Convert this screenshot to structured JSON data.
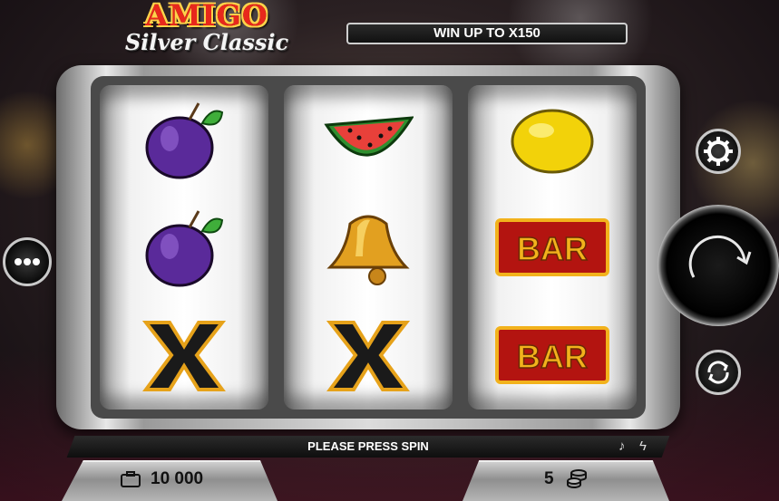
{
  "logo": {
    "line1": "AMIGO",
    "line2": "Silver Classic"
  },
  "header": {
    "win_banner": "WIN UP TO X150"
  },
  "reels": [
    {
      "symbols": [
        "plum",
        "plum",
        "x"
      ]
    },
    {
      "symbols": [
        "watermelon",
        "bell",
        "x"
      ]
    },
    {
      "symbols": [
        "lemon",
        "bar",
        "bar"
      ]
    }
  ],
  "symbol_text": {
    "bar": "BAR"
  },
  "status": {
    "message": "PLEASE PRESS SPIN"
  },
  "footer": {
    "balance": "10 000",
    "bet": "5"
  },
  "icons": {
    "menu": "more-dots-icon",
    "settings": "gear-icon",
    "spin": "spin-arrow-icon",
    "autoplay": "autoplay-arrows-icon",
    "sound": "music-note-icon",
    "turbo": "lightning-icon",
    "balance": "briefcase-icon",
    "bet": "coins-icon"
  },
  "colors": {
    "accent_red": "#e8281c",
    "gold": "#f2b21c",
    "chrome": "#dcdcdc"
  }
}
